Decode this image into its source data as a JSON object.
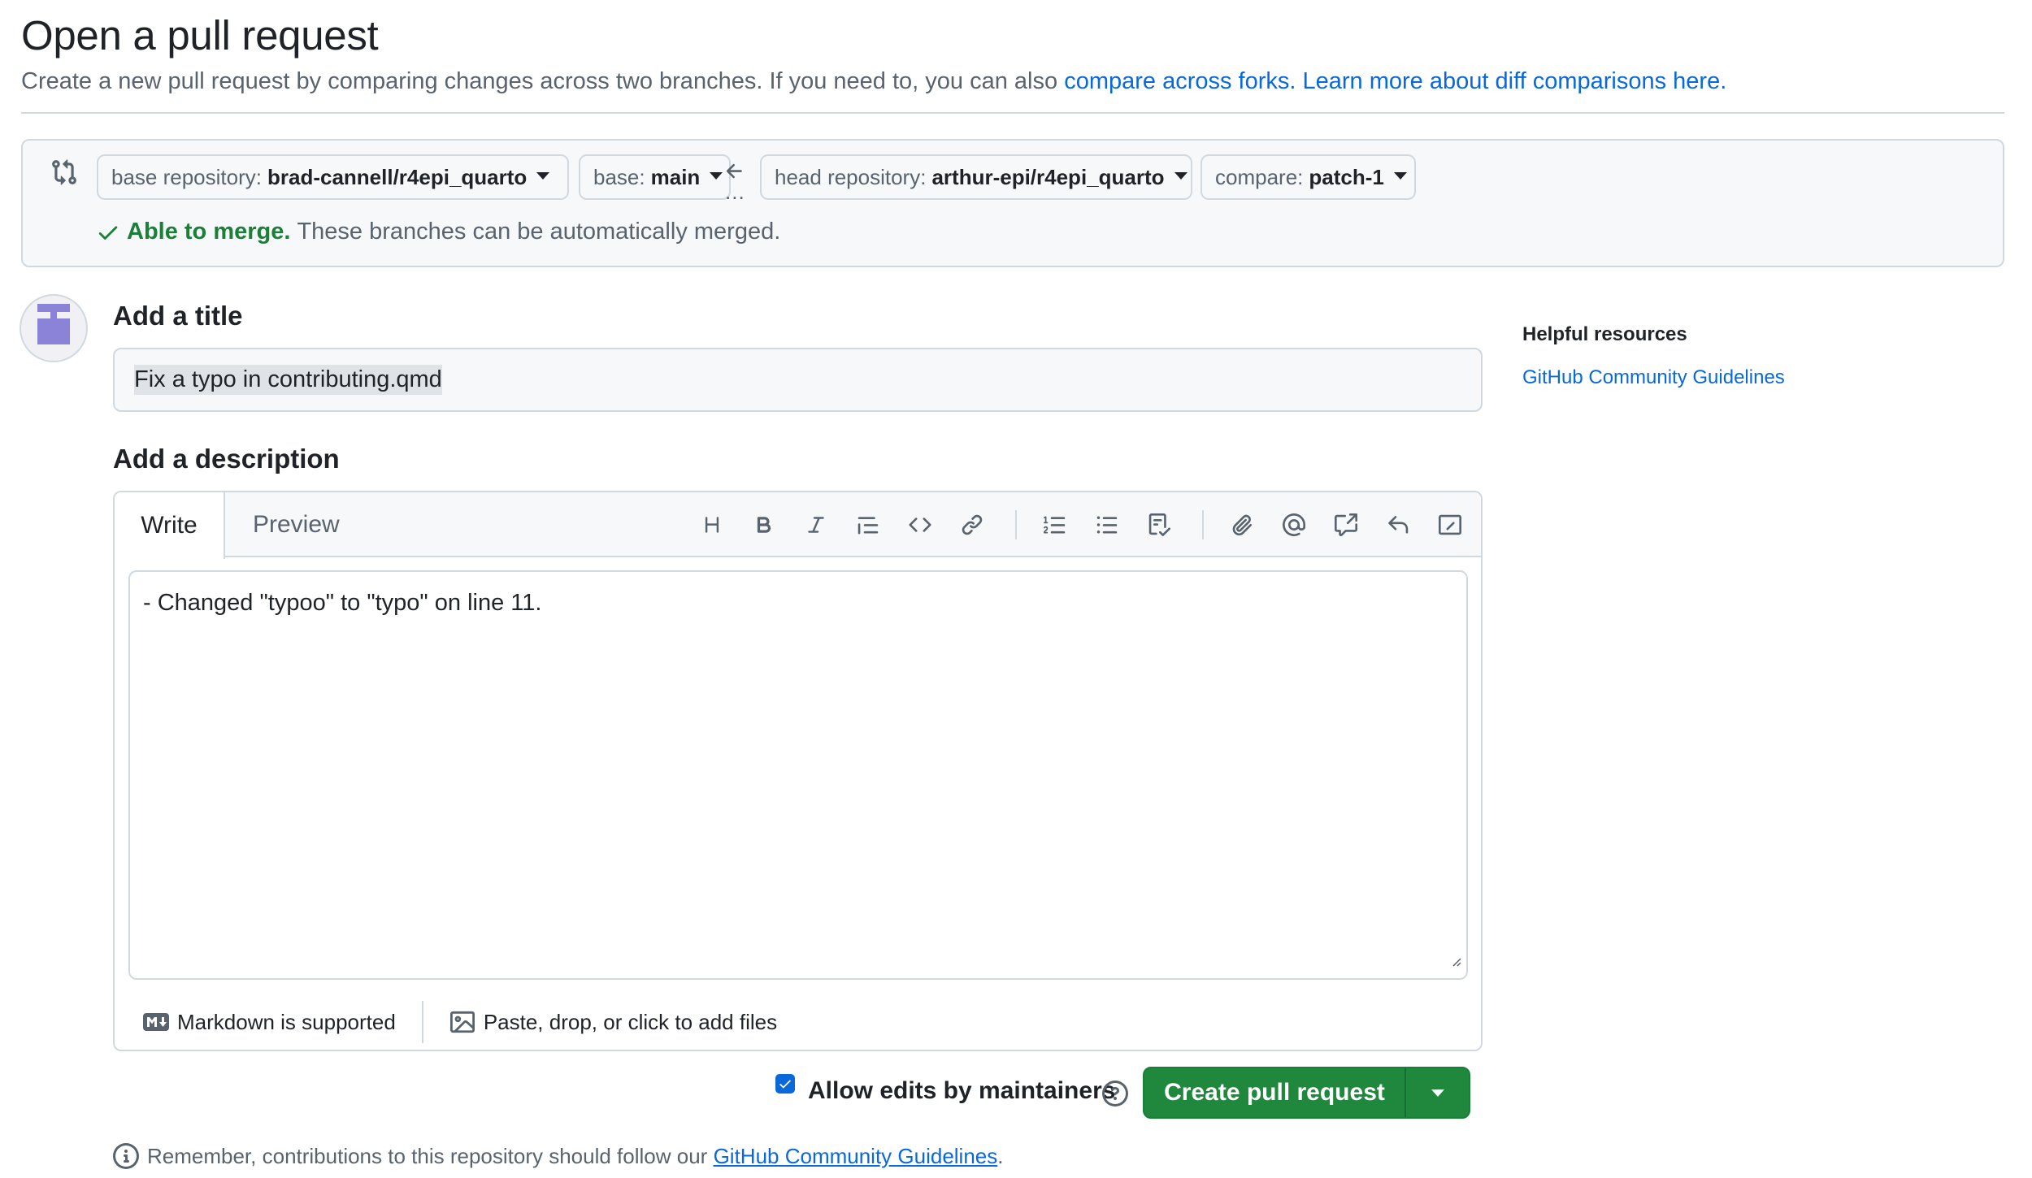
{
  "page": {
    "title": "Open a pull request",
    "subtitle_text": "Create a new pull request by comparing changes across two branches. If you need to, you can also ",
    "link_compare_forks": "compare across forks.",
    "link_learn_more": "Learn more about diff comparisons here."
  },
  "compare": {
    "base_repo_label": "base repository:",
    "base_repo_value": "brad-cannell/r4epi_quarto",
    "base_label": "base:",
    "base_value": "main",
    "ellipsis": "...",
    "head_repo_label": "head repository:",
    "head_repo_value": "arthur-epi/r4epi_quarto",
    "compare_label": "compare:",
    "compare_value": "patch-1",
    "merge_status": "Able to merge.",
    "merge_detail": "These branches can be automatically merged."
  },
  "form": {
    "title_heading": "Add a title",
    "title_value": "Fix a typo in contributing.qmd",
    "description_heading": "Add a description",
    "tabs": [
      "Write",
      "Preview"
    ],
    "toolbar_icons": [
      "heading-icon",
      "bold-icon",
      "italic-icon",
      "quote-icon",
      "code-icon",
      "link-icon",
      "ordered-list-icon",
      "unordered-list-icon",
      "task-list-icon",
      "attach-icon",
      "mention-icon",
      "reference-icon",
      "reply-icon",
      "slash-commands-icon"
    ],
    "description_value": "- Changed \"typoo\" to \"typo\" on line 11.",
    "markdown_note": "Markdown is supported",
    "files_note": "Paste, drop, or click to add files"
  },
  "actions": {
    "allow_edits_label": "Allow edits by maintainers",
    "allow_edits_checked": true,
    "create_label": "Create pull request"
  },
  "notice": {
    "text": "Remember, contributions to this repository should follow our ",
    "link": "GitHub Community Guidelines",
    "end": "."
  },
  "sidebar": {
    "heading": "Helpful resources",
    "link": "GitHub Community Guidelines"
  },
  "colors": {
    "accent": "#0969da",
    "success": "#1a7f37",
    "primary_button": "#1f883d",
    "border": "#d1d9e0",
    "muted_text": "#59636e"
  }
}
